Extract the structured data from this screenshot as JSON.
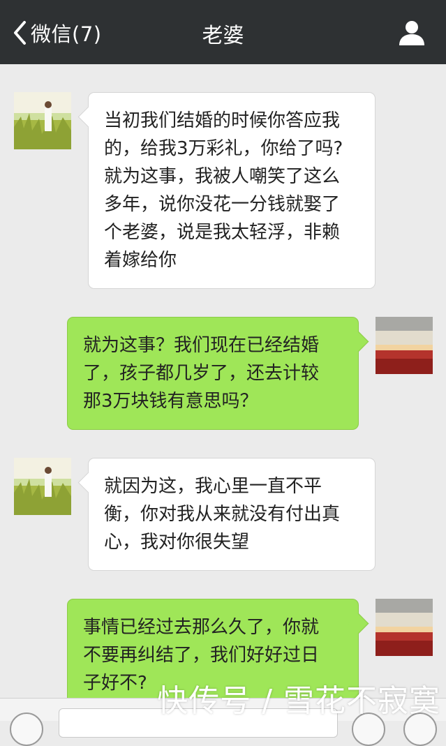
{
  "header": {
    "back_label": "微信(7)",
    "title": "老婆",
    "back_icon": "chevron-left-icon",
    "profile_icon": "person-icon"
  },
  "messages": [
    {
      "side": "in",
      "text": "当初我们结婚的时候你答应我\n的，给我3万彩礼，你给了吗?\n就为这事，我被人嘲笑了这么\n多年，说你没花一分钱就娶了\n个老婆，说是我太轻浮，非赖\n着嫁给你"
    },
    {
      "side": "out",
      "text": "就为这事？我们现在已经结婚\n了，孩子都几岁了，还去计较\n那3万块钱有意思吗？"
    },
    {
      "side": "in",
      "text": "就因为这，我心里一直不平\n衡，你对我从来就没有付出真\n心，我对你很失望"
    },
    {
      "side": "out",
      "text": "事情已经过去那么久了，你就\n不要再纠结了，我们好好过日\n子好不?"
    }
  ],
  "watermark": "快传号 / 雪花不寂寞",
  "colors": {
    "header_bg": "#2e3133",
    "chat_bg": "#ebebeb",
    "bubble_out": "#9fe658",
    "bubble_in": "#ffffff"
  }
}
